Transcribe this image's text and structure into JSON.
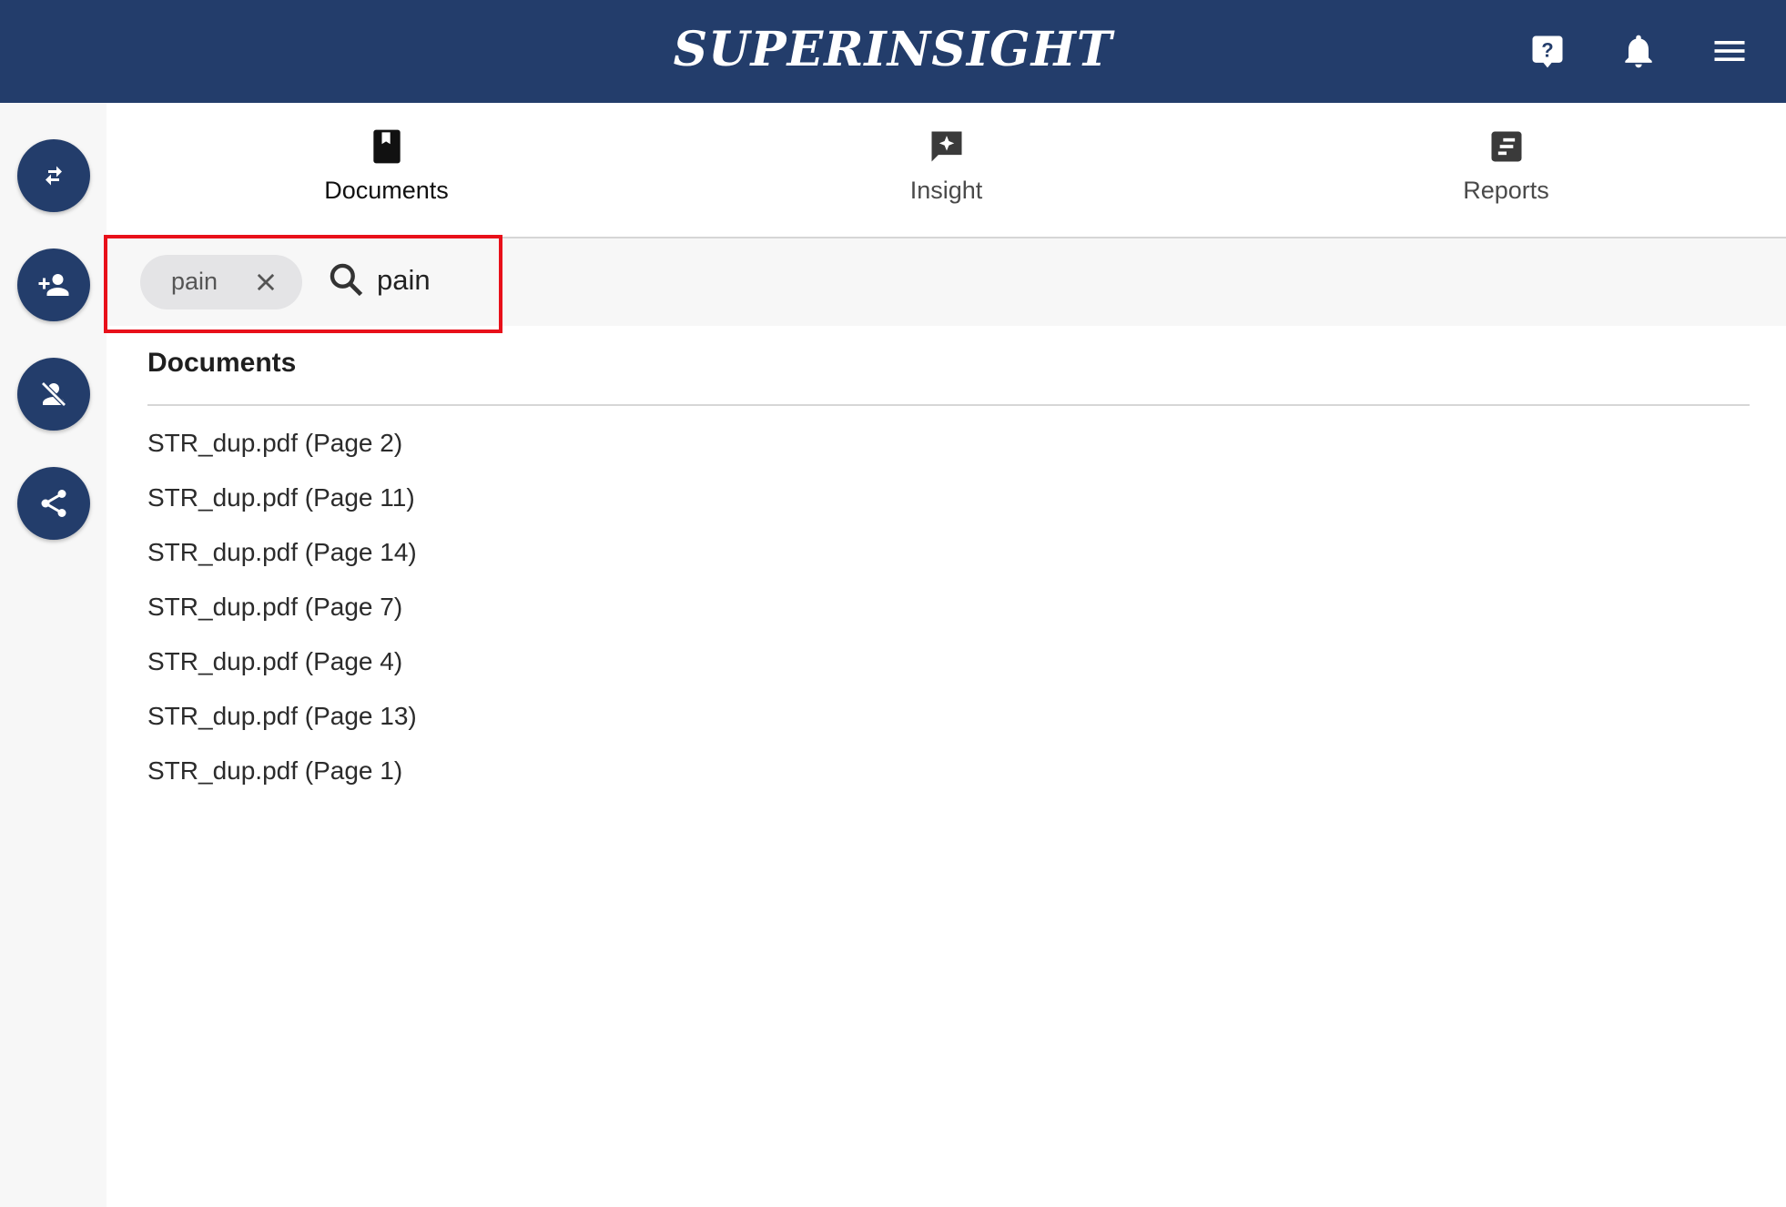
{
  "header": {
    "logo": "SUPERINSIGHT",
    "background": "#233d6b",
    "buttons": [
      {
        "icon": "help-icon"
      },
      {
        "icon": "bell-icon"
      },
      {
        "icon": "menu-icon"
      }
    ]
  },
  "sidebar": {
    "buttons": [
      {
        "icon": "swap-icon"
      },
      {
        "icon": "add-person-icon"
      },
      {
        "icon": "remove-person-icon"
      },
      {
        "icon": "share-icon"
      }
    ]
  },
  "tabs": [
    {
      "label": "Documents",
      "icon": "book-icon",
      "active": true
    },
    {
      "label": "Insight",
      "icon": "insight-icon",
      "active": false
    },
    {
      "label": "Reports",
      "icon": "report-icon",
      "active": false
    }
  ],
  "search": {
    "chip_label": "pain",
    "query": "pain",
    "highlight_color": "#e8101a"
  },
  "results": {
    "title": "Documents",
    "items": [
      "STR_dup.pdf (Page 2)",
      "STR_dup.pdf (Page 11)",
      "STR_dup.pdf (Page 14)",
      "STR_dup.pdf (Page 7)",
      "STR_dup.pdf (Page 4)",
      "STR_dup.pdf (Page 13)",
      "STR_dup.pdf (Page 1)"
    ]
  }
}
